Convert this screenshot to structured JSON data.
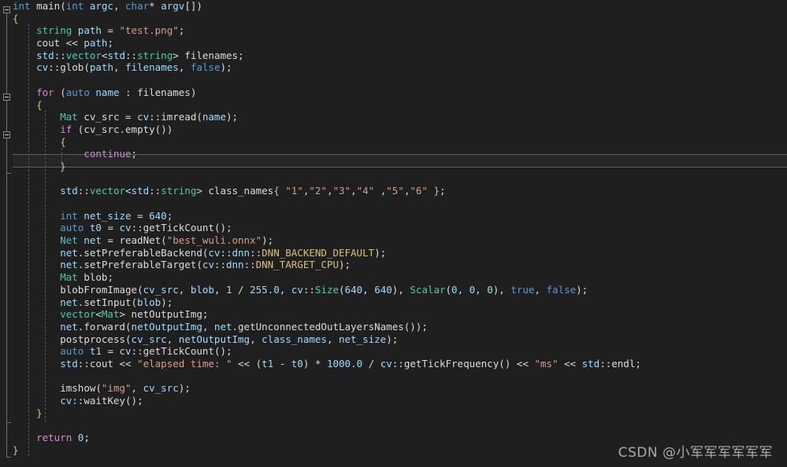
{
  "editor": {
    "background_color": "#1f1f1f",
    "current_line_number": 14,
    "current_line_color": "#262626",
    "language": "C++"
  },
  "theme": {
    "keyword_control": "#d18ad8",
    "keyword_type": "#569cd6",
    "user_type": "#4ec9b0",
    "variable": "#9cdcfe",
    "string": "#d69d85",
    "number": "#b5cea8",
    "macro": "#d8c07a",
    "plain": "#dcdcdc",
    "indent_guide": "#5a5a5a",
    "fold_marker": "#8a8a8a"
  },
  "watermark": {
    "text": "CSDN @小军军军军军军"
  },
  "code": {
    "lines": [
      "int main(int argc, char* argv[])",
      "{",
      "    string path = \"test.png\";",
      "    cout << path;",
      "    std::vector<std::string> filenames;",
      "    cv::glob(path, filenames, false);",
      "",
      "    for (auto name : filenames)",
      "    {",
      "        Mat cv_src = cv::imread(name);",
      "        if (cv_src.empty())",
      "        {",
      "            continue;",
      "        }",
      "",
      "        std::vector<std::string> class_names{ \"1\",\"2\",\"3\",\"4\" ,\"5\",\"6\" };",
      "",
      "        int net_size = 640;",
      "        auto t0 = cv::getTickCount();",
      "        Net net = readNet(\"best_wuli.onnx\");",
      "        net.setPreferableBackend(cv::dnn::DNN_BACKEND_DEFAULT);",
      "        net.setPreferableTarget(cv::dnn::DNN_TARGET_CPU);",
      "        Mat blob;",
      "        blobFromImage(cv_src, blob, 1 / 255.0, cv::Size(640, 640), Scalar(0, 0, 0), true, false);",
      "        net.setInput(blob);",
      "        vector<Mat> netOutputImg;",
      "        net.forward(netOutputImg, net.getUnconnectedOutLayersNames());",
      "        postprocess(cv_src, netOutputImg, class_names, net_size);",
      "        auto t1 = cv::getTickCount();",
      "        std::cout << \"elapsed time: \" << (t1 - t0) * 1000.0 / cv::getTickFrequency() << \"ms\" << std::endl;",
      "",
      "        imshow(\"img\", cv_src);",
      "        cv::waitKey();",
      "    }",
      "",
      "    return 0;",
      "}"
    ],
    "tokens": [
      [
        [
          "int ",
          "kw2"
        ],
        [
          "main",
          "fn"
        ],
        [
          "(",
          "punct"
        ],
        [
          "int ",
          "kw2"
        ],
        [
          "argc",
          "var"
        ],
        [
          ", ",
          "punct"
        ],
        [
          "char",
          "kw2"
        ],
        [
          "* ",
          "punct"
        ],
        [
          "argv",
          "var"
        ],
        [
          "[])",
          "punct"
        ]
      ],
      [
        [
          "{",
          "brace-y"
        ]
      ],
      [
        [
          "    ",
          "plain"
        ],
        [
          "string",
          "type"
        ],
        [
          " ",
          "plain"
        ],
        [
          "path",
          "var"
        ],
        [
          " = ",
          "punct"
        ],
        [
          "\"test.png\"",
          "str"
        ],
        [
          ";",
          "punct"
        ]
      ],
      [
        [
          "    ",
          "plain"
        ],
        [
          "cout",
          "plain"
        ],
        [
          " << ",
          "punct"
        ],
        [
          "path",
          "var"
        ],
        [
          ";",
          "punct"
        ]
      ],
      [
        [
          "    ",
          "plain"
        ],
        [
          "std",
          "var"
        ],
        [
          "::",
          "punct"
        ],
        [
          "vector",
          "type"
        ],
        [
          "<",
          "punct"
        ],
        [
          "std",
          "var"
        ],
        [
          "::",
          "punct"
        ],
        [
          "string",
          "type"
        ],
        [
          "> ",
          "punct"
        ],
        [
          "filenames",
          "plain"
        ],
        [
          ";",
          "punct"
        ]
      ],
      [
        [
          "    ",
          "plain"
        ],
        [
          "cv",
          "var"
        ],
        [
          "::",
          "punct"
        ],
        [
          "glob",
          "fn"
        ],
        [
          "(",
          "punct"
        ],
        [
          "path",
          "var"
        ],
        [
          ", ",
          "punct"
        ],
        [
          "filenames",
          "var"
        ],
        [
          ", ",
          "punct"
        ],
        [
          "false",
          "kw2"
        ],
        [
          ");",
          "punct"
        ]
      ],
      [
        [
          "",
          "plain"
        ]
      ],
      [
        [
          "    ",
          "plain"
        ],
        [
          "for",
          "kw"
        ],
        [
          " (",
          "punct"
        ],
        [
          "auto",
          "kw2"
        ],
        [
          " ",
          "plain"
        ],
        [
          "name",
          "var"
        ],
        [
          " : ",
          "punct"
        ],
        [
          "filenames",
          "plain"
        ],
        [
          ")",
          "punct"
        ]
      ],
      [
        [
          "    ",
          "plain"
        ],
        [
          "{",
          "brace-y"
        ]
      ],
      [
        [
          "        ",
          "plain"
        ],
        [
          "Mat",
          "type"
        ],
        [
          " ",
          "plain"
        ],
        [
          "cv_src",
          "plain"
        ],
        [
          " = ",
          "punct"
        ],
        [
          "cv",
          "var"
        ],
        [
          "::",
          "punct"
        ],
        [
          "imread",
          "fn"
        ],
        [
          "(",
          "punct"
        ],
        [
          "name",
          "var"
        ],
        [
          ");",
          "punct"
        ]
      ],
      [
        [
          "        ",
          "plain"
        ],
        [
          "if",
          "kw"
        ],
        [
          " (",
          "punct"
        ],
        [
          "cv_src",
          "plain"
        ],
        [
          ".",
          "punct"
        ],
        [
          "empty",
          "fn"
        ],
        [
          "())",
          "punct"
        ]
      ],
      [
        [
          "        ",
          "plain"
        ],
        [
          "{",
          "brace-y"
        ]
      ],
      [
        [
          "            ",
          "plain"
        ],
        [
          "continue",
          "kw"
        ],
        [
          ";",
          "punct"
        ]
      ],
      [
        [
          "        ",
          "plain"
        ],
        [
          "}",
          "brace-y"
        ]
      ],
      [
        [
          "",
          "plain"
        ]
      ],
      [
        [
          "        ",
          "plain"
        ],
        [
          "std",
          "var"
        ],
        [
          "::",
          "punct"
        ],
        [
          "vector",
          "type"
        ],
        [
          "<",
          "punct"
        ],
        [
          "std",
          "var"
        ],
        [
          "::",
          "punct"
        ],
        [
          "string",
          "type"
        ],
        [
          "> ",
          "punct"
        ],
        [
          "class_names",
          "plain"
        ],
        [
          "{ ",
          "brace-y"
        ],
        [
          "\"1\"",
          "str"
        ],
        [
          ",",
          "punct"
        ],
        [
          "\"2\"",
          "str"
        ],
        [
          ",",
          "punct"
        ],
        [
          "\"3\"",
          "str"
        ],
        [
          ",",
          "punct"
        ],
        [
          "\"4\"",
          "str"
        ],
        [
          " ,",
          "punct"
        ],
        [
          "\"5\"",
          "str"
        ],
        [
          ",",
          "punct"
        ],
        [
          "\"6\"",
          "str"
        ],
        [
          " }",
          "brace-y"
        ],
        [
          ";",
          "punct"
        ]
      ],
      [
        [
          "",
          "plain"
        ]
      ],
      [
        [
          "        ",
          "plain"
        ],
        [
          "int",
          "kw2"
        ],
        [
          " ",
          "plain"
        ],
        [
          "net_size",
          "var"
        ],
        [
          " = ",
          "punct"
        ],
        [
          "640",
          "var"
        ],
        [
          ";",
          "punct"
        ]
      ],
      [
        [
          "        ",
          "plain"
        ],
        [
          "auto",
          "kw2"
        ],
        [
          " ",
          "plain"
        ],
        [
          "t0",
          "var"
        ],
        [
          " = ",
          "punct"
        ],
        [
          "cv",
          "var"
        ],
        [
          "::",
          "punct"
        ],
        [
          "getTickCount",
          "fn"
        ],
        [
          "();",
          "punct"
        ]
      ],
      [
        [
          "        ",
          "plain"
        ],
        [
          "Net",
          "type"
        ],
        [
          " ",
          "plain"
        ],
        [
          "net",
          "var"
        ],
        [
          " = ",
          "punct"
        ],
        [
          "readNet",
          "fn"
        ],
        [
          "(",
          "punct"
        ],
        [
          "\"best_wuli.onnx\"",
          "str"
        ],
        [
          ");",
          "punct"
        ]
      ],
      [
        [
          "        ",
          "plain"
        ],
        [
          "net",
          "var"
        ],
        [
          ".",
          "punct"
        ],
        [
          "setPreferableBackend",
          "fn"
        ],
        [
          "(",
          "punct"
        ],
        [
          "cv",
          "var"
        ],
        [
          "::",
          "punct"
        ],
        [
          "dnn",
          "var"
        ],
        [
          "::",
          "punct"
        ],
        [
          "DNN_BACKEND_DEFAULT",
          "macro"
        ],
        [
          ");",
          "punct"
        ]
      ],
      [
        [
          "        ",
          "plain"
        ],
        [
          "net",
          "var"
        ],
        [
          ".",
          "punct"
        ],
        [
          "setPreferableTarget",
          "fn"
        ],
        [
          "(",
          "punct"
        ],
        [
          "cv",
          "var"
        ],
        [
          "::",
          "punct"
        ],
        [
          "dnn",
          "var"
        ],
        [
          "::",
          "punct"
        ],
        [
          "DNN_TARGET_CPU",
          "macro"
        ],
        [
          ");",
          "punct"
        ]
      ],
      [
        [
          "        ",
          "plain"
        ],
        [
          "Mat",
          "type"
        ],
        [
          " ",
          "plain"
        ],
        [
          "blob",
          "plain"
        ],
        [
          ";",
          "punct"
        ]
      ],
      [
        [
          "        ",
          "plain"
        ],
        [
          "blobFromImage",
          "fn"
        ],
        [
          "(",
          "punct"
        ],
        [
          "cv_src",
          "var"
        ],
        [
          ", ",
          "punct"
        ],
        [
          "blob",
          "var"
        ],
        [
          ", ",
          "punct"
        ],
        [
          "1",
          "var"
        ],
        [
          " / ",
          "punct"
        ],
        [
          "255.0",
          "var"
        ],
        [
          ", ",
          "punct"
        ],
        [
          "cv",
          "var"
        ],
        [
          "::",
          "punct"
        ],
        [
          "Size",
          "type"
        ],
        [
          "(",
          "punct"
        ],
        [
          "640",
          "var"
        ],
        [
          ", ",
          "punct"
        ],
        [
          "640",
          "var"
        ],
        [
          "), ",
          "punct"
        ],
        [
          "Scalar",
          "type"
        ],
        [
          "(",
          "punct"
        ],
        [
          "0",
          "var"
        ],
        [
          ", ",
          "punct"
        ],
        [
          "0",
          "var"
        ],
        [
          ", ",
          "punct"
        ],
        [
          "0",
          "var"
        ],
        [
          "), ",
          "punct"
        ],
        [
          "true",
          "kw2"
        ],
        [
          ", ",
          "punct"
        ],
        [
          "false",
          "kw2"
        ],
        [
          ");",
          "punct"
        ]
      ],
      [
        [
          "        ",
          "plain"
        ],
        [
          "net",
          "var"
        ],
        [
          ".",
          "punct"
        ],
        [
          "setInput",
          "fn"
        ],
        [
          "(",
          "punct"
        ],
        [
          "blob",
          "var"
        ],
        [
          ");",
          "punct"
        ]
      ],
      [
        [
          "        ",
          "plain"
        ],
        [
          "vector",
          "type"
        ],
        [
          "<",
          "punct"
        ],
        [
          "Mat",
          "type"
        ],
        [
          "> ",
          "punct"
        ],
        [
          "netOutputImg",
          "plain"
        ],
        [
          ";",
          "punct"
        ]
      ],
      [
        [
          "        ",
          "plain"
        ],
        [
          "net",
          "var"
        ],
        [
          ".",
          "punct"
        ],
        [
          "forward",
          "fn"
        ],
        [
          "(",
          "punct"
        ],
        [
          "netOutputImg",
          "var"
        ],
        [
          ", ",
          "punct"
        ],
        [
          "net",
          "var"
        ],
        [
          ".",
          "punct"
        ],
        [
          "getUnconnectedOutLayersNames",
          "fn"
        ],
        [
          "());",
          "punct"
        ]
      ],
      [
        [
          "        ",
          "plain"
        ],
        [
          "postprocess",
          "fn"
        ],
        [
          "(",
          "punct"
        ],
        [
          "cv_src",
          "var"
        ],
        [
          ", ",
          "punct"
        ],
        [
          "netOutputImg",
          "var"
        ],
        [
          ", ",
          "punct"
        ],
        [
          "class_names",
          "var"
        ],
        [
          ", ",
          "punct"
        ],
        [
          "net_size",
          "var"
        ],
        [
          ");",
          "punct"
        ]
      ],
      [
        [
          "        ",
          "plain"
        ],
        [
          "auto",
          "kw2"
        ],
        [
          " ",
          "plain"
        ],
        [
          "t1",
          "var"
        ],
        [
          " = ",
          "punct"
        ],
        [
          "cv",
          "var"
        ],
        [
          "::",
          "punct"
        ],
        [
          "getTickCount",
          "fn"
        ],
        [
          "();",
          "punct"
        ]
      ],
      [
        [
          "        ",
          "plain"
        ],
        [
          "std",
          "var"
        ],
        [
          "::",
          "punct"
        ],
        [
          "cout",
          "plain"
        ],
        [
          " << ",
          "punct"
        ],
        [
          "\"elapsed time: \"",
          "str"
        ],
        [
          " << (",
          "punct"
        ],
        [
          "t1",
          "var"
        ],
        [
          " - ",
          "punct"
        ],
        [
          "t0",
          "var"
        ],
        [
          ") * ",
          "punct"
        ],
        [
          "1000.0",
          "var"
        ],
        [
          " / ",
          "punct"
        ],
        [
          "cv",
          "var"
        ],
        [
          "::",
          "punct"
        ],
        [
          "getTickFrequency",
          "fn"
        ],
        [
          "() << ",
          "punct"
        ],
        [
          "\"ms\"",
          "str"
        ],
        [
          " << ",
          "punct"
        ],
        [
          "std",
          "var"
        ],
        [
          "::",
          "punct"
        ],
        [
          "endl",
          "plain"
        ],
        [
          ";",
          "punct"
        ]
      ],
      [
        [
          "",
          "plain"
        ]
      ],
      [
        [
          "        ",
          "plain"
        ],
        [
          "imshow",
          "fn"
        ],
        [
          "(",
          "punct"
        ],
        [
          "\"img\"",
          "str"
        ],
        [
          ", ",
          "punct"
        ],
        [
          "cv_src",
          "var"
        ],
        [
          ");",
          "punct"
        ]
      ],
      [
        [
          "        ",
          "plain"
        ],
        [
          "cv",
          "var"
        ],
        [
          "::",
          "punct"
        ],
        [
          "waitKey",
          "fn"
        ],
        [
          "();",
          "punct"
        ]
      ],
      [
        [
          "    ",
          "plain"
        ],
        [
          "}",
          "brace-y"
        ]
      ],
      [
        [
          "",
          "plain"
        ]
      ],
      [
        [
          "    ",
          "plain"
        ],
        [
          "return",
          "kw"
        ],
        [
          " ",
          "plain"
        ],
        [
          "0",
          "var"
        ],
        [
          ";",
          "punct"
        ]
      ],
      [
        [
          "}",
          "brace-y"
        ]
      ]
    ]
  }
}
